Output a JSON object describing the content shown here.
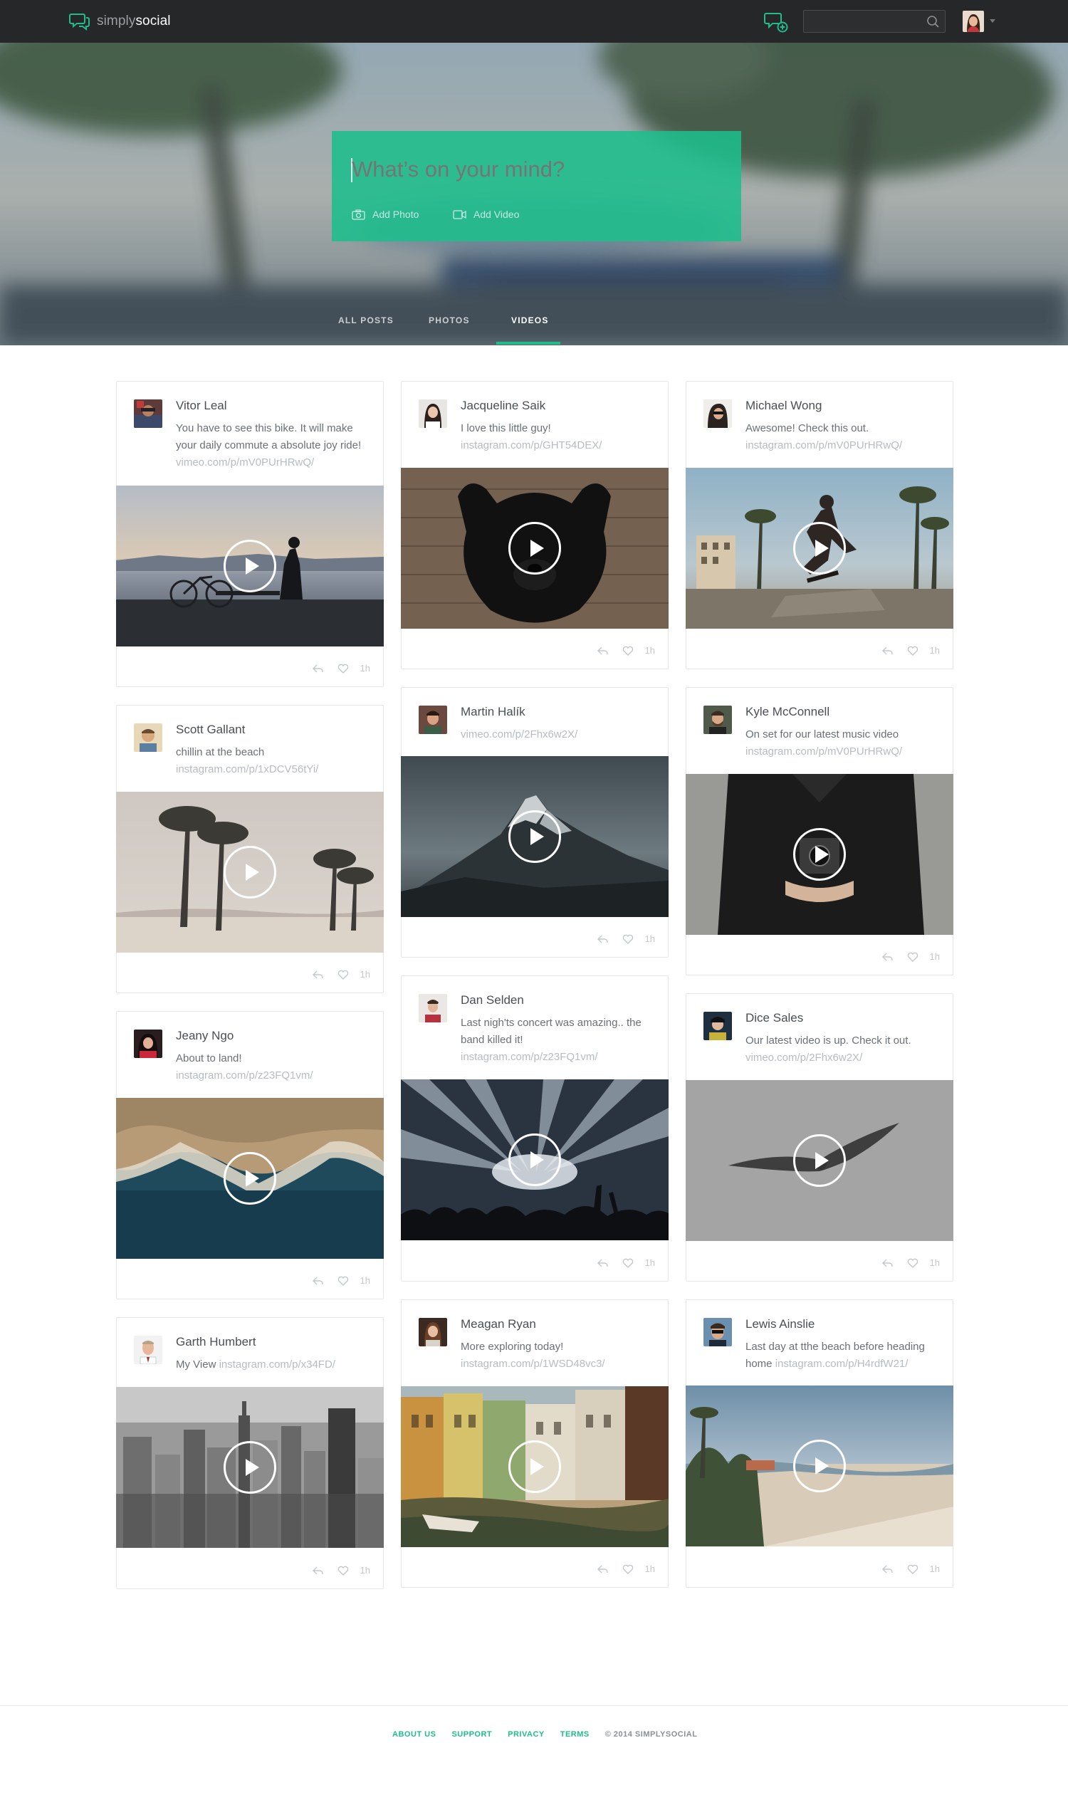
{
  "brand": {
    "name_light": "simply",
    "name_bold": "social",
    "accent": "#1fbd8c"
  },
  "header": {
    "search": {
      "placeholder": "",
      "value": ""
    },
    "icons": [
      "chat-logo-icon",
      "compose-chat-icon",
      "search-icon",
      "caret-down-icon"
    ]
  },
  "composer": {
    "placeholder": "What’s on your mind?",
    "add_photo": "Add Photo",
    "add_video": "Add Video"
  },
  "tabs": [
    {
      "label": "ALL POSTS",
      "active": false
    },
    {
      "label": "PHOTOS",
      "active": false
    },
    {
      "label": "VIDEOS",
      "active": true
    }
  ],
  "posts": [
    {
      "author": "Vitor Leal",
      "text": "You have to see this bike. It will make your daily commute a absolute joy ride!",
      "link": "vimeo.com/p/mV0PUrHRwQ/",
      "time": "1h"
    },
    {
      "author": "Scott Gallant",
      "text": "chillin at the beach",
      "link": "instagram.com/p/1xDCV56tYi/",
      "time": "1h"
    },
    {
      "author": "Jeany Ngo",
      "text": "About to land!",
      "link": "instagram.com/p/z23FQ1vm/",
      "time": "1h"
    },
    {
      "author": "Garth Humbert",
      "text": "My View",
      "link": "instagram.com/p/x34FD/",
      "time": "1h"
    },
    {
      "author": "Jacqueline Saik",
      "text": "I love this little guy!",
      "link": "instagram.com/p/GHT54DEX/",
      "time": "1h"
    },
    {
      "author": "Martin Halík",
      "text": "",
      "link": "vimeo.com/p/2Fhx6w2X/",
      "time": "1h"
    },
    {
      "author": "Dan Selden",
      "text": "Last nigh'ts concert was amazing.. the band killed it!",
      "link": "instagram.com/p/z23FQ1vm/",
      "time": "1h"
    },
    {
      "author": "Meagan Ryan",
      "text": "More exploring today!",
      "link": "instagram.com/p/1WSD48vc3/",
      "time": "1h"
    },
    {
      "author": "Michael Wong",
      "text": "Awesome! Check this out.",
      "link": "instagram.com/p/mV0PUrHRwQ/",
      "time": "1h"
    },
    {
      "author": "Kyle McConnell",
      "text": "On set for our latest music video",
      "link": "instagram.com/p/mV0PUrHRwQ/",
      "time": "1h"
    },
    {
      "author": "Dice Sales",
      "text": "Our latest video is up. Check it out.",
      "link": "vimeo.com/p/2Fhx6w2X/",
      "time": "1h"
    },
    {
      "author": "Lewis Ainslie",
      "text": "Last day at tthe beach before heading home",
      "link": "instagram.com/p/H4rdfW21/",
      "time": "1h"
    }
  ],
  "footer": {
    "links": [
      "ABOUT US",
      "SUPPORT",
      "PRIVACY",
      "TERMS"
    ],
    "copyright": "© 2014 SIMPLYSOCIAL"
  }
}
